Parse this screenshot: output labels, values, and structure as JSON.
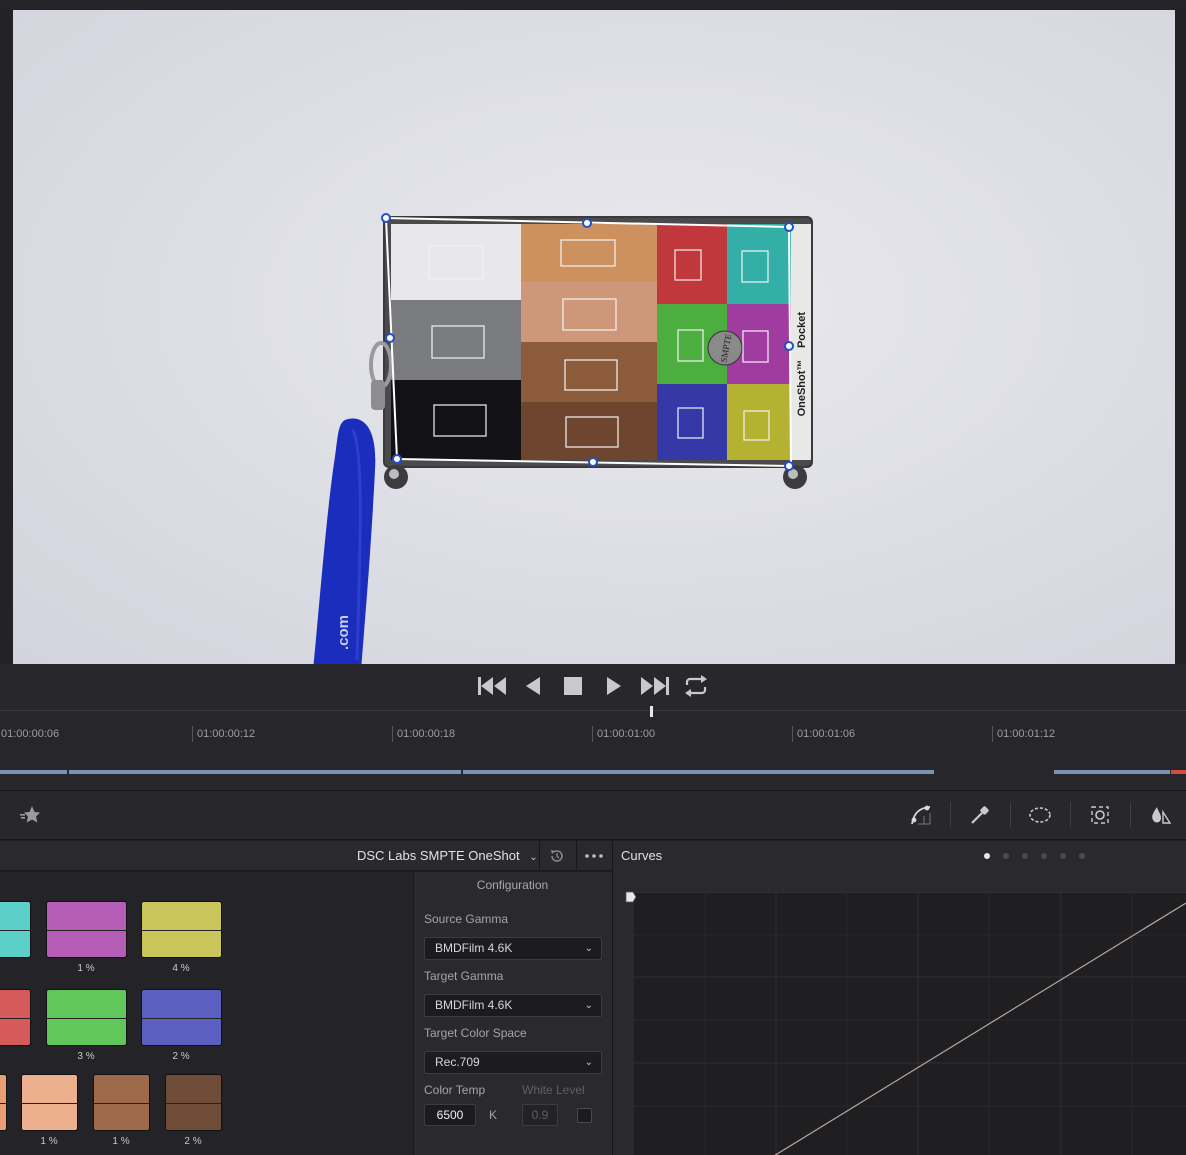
{
  "viewer": {
    "chart_brand_vertical": "Pocket",
    "chart_model_vertical": "OneShot™",
    "lanyard_text": ".com",
    "seal_text": "SMPTE"
  },
  "transport": {
    "buttons": [
      "skip-to-start",
      "step-back",
      "stop",
      "play",
      "skip-to-end",
      "loop"
    ]
  },
  "timeline": {
    "ticks": [
      "01:00:00:06",
      "01:00:00:12",
      "01:00:00:18",
      "01:00:01:00",
      "01:00:01:06",
      "01:00:01:12"
    ]
  },
  "chart_panel": {
    "chart_name": "DSC Labs SMPTE OneShot",
    "swatches": [
      {
        "color": "#5ccfca",
        "pct": ""
      },
      {
        "color": "#b65db8",
        "pct": "1 %"
      },
      {
        "color": "#c9c55a",
        "pct": "4 %"
      },
      {
        "color": "#d65a5a",
        "pct": ""
      },
      {
        "color": "#62c75a",
        "pct": "3 %"
      },
      {
        "color": "#5b5fbf",
        "pct": "2 %"
      },
      {
        "color": "#e89f73",
        "pct": ""
      },
      {
        "color": "#edb08f",
        "pct": "1 %"
      },
      {
        "color": "#9f6a4b",
        "pct": "1 %"
      },
      {
        "color": "#6e4c38",
        "pct": "2 %"
      }
    ]
  },
  "configuration": {
    "title": "Configuration",
    "source_gamma_label": "Source Gamma",
    "source_gamma_value": "BMDFilm 4.6K",
    "target_gamma_label": "Target Gamma",
    "target_gamma_value": "BMDFilm 4.6K",
    "target_color_space_label": "Target Color Space",
    "target_color_space_value": "Rec.709",
    "color_temp_label": "Color Temp",
    "color_temp_value": "6500",
    "color_temp_unit": "K",
    "white_level_label": "White Level",
    "white_level_value": "0.9"
  },
  "curves": {
    "title": "Curves",
    "page_count": 6,
    "active_page": 1
  }
}
